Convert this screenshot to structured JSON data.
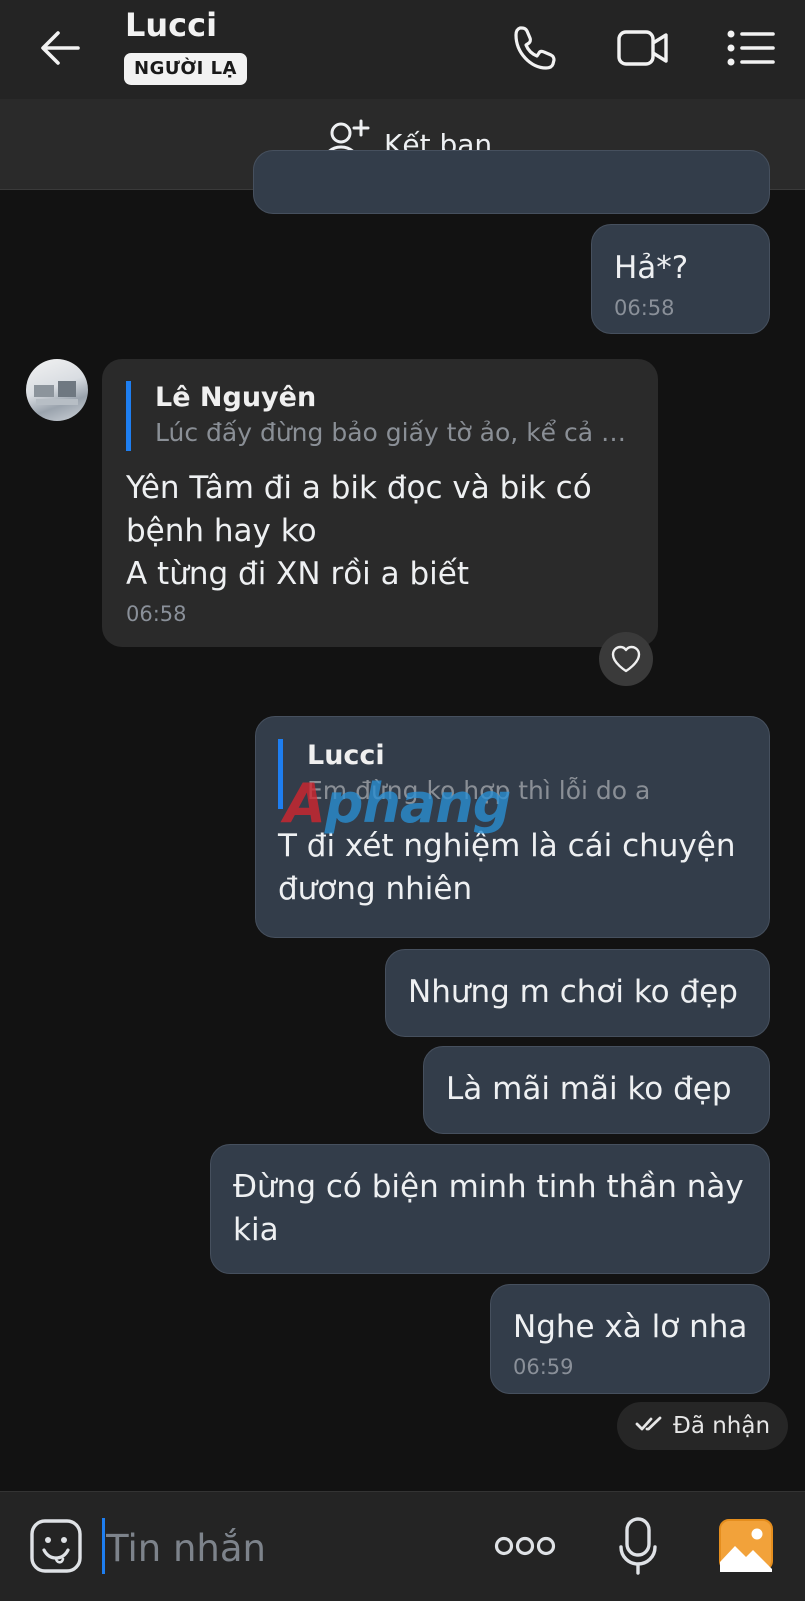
{
  "header": {
    "contact_name": "Lucci",
    "status_badge": "NGƯỜI LẠ"
  },
  "friend_bar": {
    "label": "Kết bạn"
  },
  "messages": {
    "m1": {
      "text": "Hả*?",
      "time": "06:58"
    },
    "m2": {
      "quote_name": "Lê Nguyên",
      "quote_text": "Lúc đấy đừng bảo giấy tờ ảo, kể cả t...",
      "text": "Yên Tâm đi a bik đọc và bik có\nbệnh hay ko\nA từng đi XN rồi a biết",
      "time": "06:58"
    },
    "m3": {
      "quote_name": "Lucci",
      "quote_text": "Em đừng ko hợp thì lỗi do a",
      "text": "T đi xét nghiệm là cái chuyện\nđương nhiên"
    },
    "m4": {
      "text": "Nhưng m chơi ko đẹp"
    },
    "m5": {
      "text": "Là mãi mãi ko đẹp"
    },
    "m6": {
      "text": "Đừng có biện minh tinh thần này\nkia"
    },
    "m7": {
      "text": "Nghe xà lơ nha",
      "time": "06:59"
    },
    "status": "Đã nhận"
  },
  "watermark": {
    "part1": "A",
    "part2": "phang"
  },
  "composer": {
    "placeholder": "Tin nhắn"
  },
  "colors": {
    "accent": "#1e7ef0",
    "my_bubble": "#333d4a",
    "their_bubble": "#2a2a2a",
    "background": "#121212"
  }
}
